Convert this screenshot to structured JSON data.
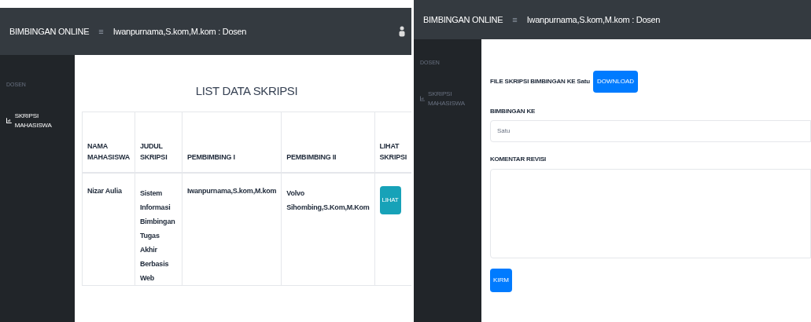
{
  "screens": [
    {
      "kind": "list",
      "brand": "BIMBINGAN ONLINE",
      "menu_icon": "≡",
      "user": "Iwanpurnama,S.kom,M.kom : Dosen",
      "sidebar": {
        "heading": "DOSEN",
        "items": [
          {
            "label": "SKRIPSI MAHASISWA",
            "selected": true
          }
        ]
      },
      "title": "LIST DATA SKRIPSI",
      "table": {
        "columns": [
          "NAMA MAHASISWA",
          "JUDUL SKRIPSI",
          "PEMBIMBING I",
          "PEMBIMBING II",
          "LIHAT SKRIPSI"
        ],
        "rows": [
          {
            "nama": "Nizar Aulia",
            "judul": "Sistem Informasi Bimbingan Tugas Akhir Berbasis Web",
            "pembimbing_1": "Iwanpurnama,S.kom,M.kom",
            "pembimbing_2": "Volvo Sihombing,S.Kom,M.Kom",
            "button": "LIHAT"
          }
        ]
      }
    },
    {
      "kind": "form",
      "brand": "BIMBINGAN ONLINE",
      "menu_icon": "≡",
      "user": "Iwanpurnama,S.kom,M.kom : Dosen",
      "sidebar": {
        "heading": "DOSEN",
        "items": [
          {
            "label": "SKRIPSI MAHASISWA",
            "selected": false
          }
        ]
      },
      "file_label": "FILE SKRIPSI BIMBINGAN KE Satu",
      "download_button": "DOWNLOAD",
      "bimbingan_label": "BIMBINGAN KE",
      "bimbingan_value": "Satu",
      "komentar_label": "KOMENTAR REVISI",
      "submit_button": "KIRM"
    }
  ]
}
